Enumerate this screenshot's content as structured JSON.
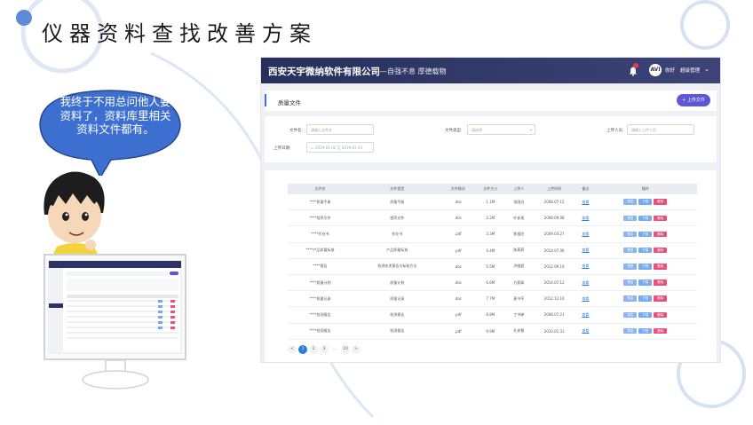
{
  "slide": {
    "title": "仪器资料查找改善方案",
    "bubble_text": "我终于不用总问他人要资料了，资料库里相关资料文件都有。"
  },
  "app": {
    "company": "西安天宇微纳软件有限公司",
    "slogan": "——自强不息  厚德载物",
    "greeting": "你好",
    "user_name": "超级管理",
    "avatar_text": "AVI",
    "page_title": "质量文件",
    "upload_label": "+ 上传文件",
    "filters": {
      "file_name_label": "文件名:",
      "file_name_placeholder": "请输入文件名",
      "file_type_label": "文件类型:",
      "file_type_placeholder": "请选择",
      "uploader_label": "上传人员:",
      "uploader_placeholder": "请输入上传人员",
      "date_label": "上传日期:",
      "date_from": "2019-01-02",
      "date_sep": "至",
      "date_to": "2019-01-03"
    },
    "table": {
      "columns": [
        "文件名",
        "文件类型",
        "文件格式",
        "文件大小",
        "上传人",
        "上传时间",
        "备注",
        "操作"
      ],
      "rows": [
        {
          "name": "****质量手册",
          "type": "质量手册",
          "format": ".doc",
          "size": "1.1M",
          "uploader": "张国治",
          "time": "2008.07.15"
        },
        {
          "name": "****程序文件",
          "type": "程序文件",
          "format": ".doc",
          "size": "2.2M",
          "uploader": "叶安现",
          "time": "2008.09.08"
        },
        {
          "name": "****作业书",
          "type": "作业书",
          "format": ".pdf",
          "size": "3.3M",
          "uploader": "陈祖民",
          "time": "2009.03.27"
        },
        {
          "name": "****产品质量标准",
          "type": "产品质量标准",
          "format": ".pdf",
          "size": "4.4M",
          "uploader": "陈燕燕",
          "time": "2014.07.06"
        },
        {
          "name": "****报告",
          "type": "检测技术报告与标准方法",
          "format": ".doc",
          "size": "5.5M",
          "uploader": "洪维超",
          "time": "2012.09.10"
        },
        {
          "name": "****质量计划",
          "type": "质量计划",
          "format": ".doc",
          "size": "6.6M",
          "uploader": "方燕翠",
          "time": "2014.07.12"
        },
        {
          "name": "****质量记录",
          "type": "质量记录",
          "format": ".doc",
          "size": "7.7M",
          "uploader": "麦书亨",
          "time": "2012.12.10"
        },
        {
          "name": "****检测报告",
          "type": "检测报告",
          "format": ".pdf",
          "size": "8.8M",
          "uploader": "丁书婷",
          "time": "2008.07.21"
        },
        {
          "name": "****检测报告",
          "type": "检测报告",
          "format": ".pdf",
          "size": "9.9M",
          "uploader": "孔祥慧",
          "time": "2010.01.31"
        }
      ],
      "remark_link": "查看",
      "actions": [
        "预览",
        "下载",
        "删除"
      ]
    },
    "pagination": [
      "<",
      "1",
      "2",
      "3",
      "...",
      "10",
      ">"
    ]
  },
  "colors": {
    "header_start": "#26305a",
    "header_end": "#3c4478",
    "bubble": "#3c6fd0",
    "accent_blue": "#2d7bd8",
    "delete_pink": "#e8527a",
    "upload_purple": "#5b57d6"
  }
}
